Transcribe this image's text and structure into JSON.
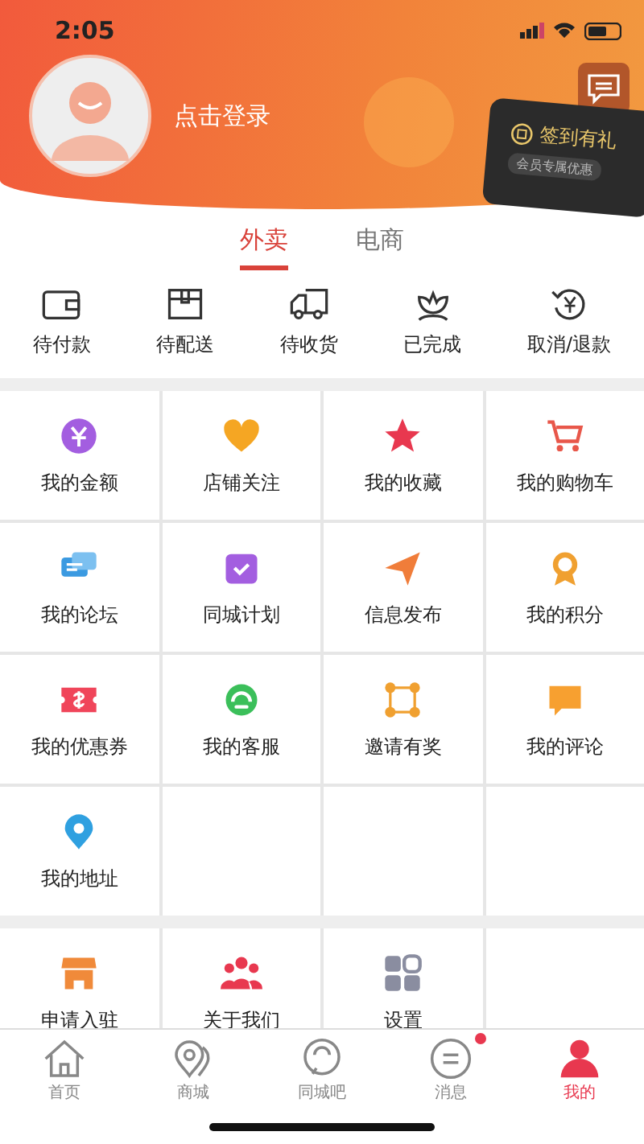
{
  "status_bar": {
    "time": "2:05"
  },
  "header": {
    "login": "点击登录",
    "sign_in": {
      "title": "签到有礼",
      "subtitle": "会员专属优惠"
    }
  },
  "tabs": [
    {
      "label": "外卖",
      "selected": true
    },
    {
      "label": "电商",
      "selected": false
    }
  ],
  "orders": [
    {
      "label": "待付款"
    },
    {
      "label": "待配送"
    },
    {
      "label": "待收货"
    },
    {
      "label": "已完成"
    },
    {
      "label": "取消/退款"
    }
  ],
  "sections": [
    {
      "items": [
        {
          "label": "我的金额"
        },
        {
          "label": "店铺关注"
        },
        {
          "label": "我的收藏"
        },
        {
          "label": "我的购物车"
        },
        {
          "label": "我的论坛"
        },
        {
          "label": "同城计划"
        },
        {
          "label": "信息发布"
        },
        {
          "label": "我的积分"
        },
        {
          "label": "我的优惠券"
        },
        {
          "label": "我的客服"
        },
        {
          "label": "邀请有奖"
        },
        {
          "label": "我的评论"
        },
        {
          "label": "我的地址"
        }
      ]
    },
    {
      "items": [
        {
          "label": "申请入驻"
        },
        {
          "label": "关于我们"
        },
        {
          "label": "设置"
        }
      ]
    }
  ],
  "nav": [
    {
      "label": "首页",
      "selected": false,
      "dot": false
    },
    {
      "label": "商城",
      "selected": false,
      "dot": false
    },
    {
      "label": "同城吧",
      "selected": false,
      "dot": false
    },
    {
      "label": "消息",
      "selected": false,
      "dot": true
    },
    {
      "label": "我的",
      "selected": true,
      "dot": false
    }
  ]
}
